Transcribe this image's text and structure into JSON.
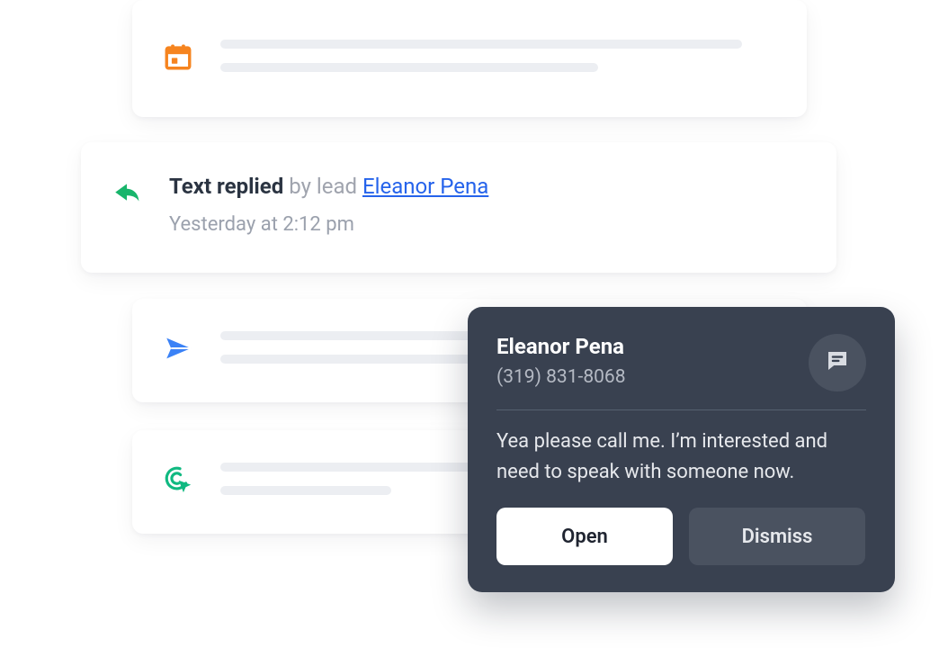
{
  "activity": {
    "reply": {
      "action_strong": "Text replied",
      "action_rest": " by lead ",
      "lead_name": "Eleanor Pena",
      "timestamp": "Yesterday at 2:12 pm"
    }
  },
  "toast": {
    "name": "Eleanor Pena",
    "phone": "(319) 831-8068",
    "message": "Yea please call me. I’m interested and need to speak with someone now.",
    "open_label": "Open",
    "dismiss_label": "Dismiss"
  }
}
